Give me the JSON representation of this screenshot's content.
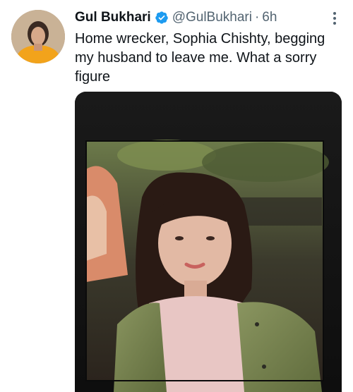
{
  "tweet": {
    "display_name": "Gul Bukhari",
    "handle": "@GulBukhari",
    "separator": "·",
    "time": "6h",
    "text": "Home wrecker, Sophia Chishty, begging\nmy husband to leave me. What a sorry\nfigure"
  },
  "icons": {
    "verified": "verified-badge-icon",
    "more": "more-options-icon"
  },
  "colors": {
    "verified_blue": "#1d9bf0",
    "text_primary": "#0f1419",
    "text_secondary": "#536471"
  }
}
